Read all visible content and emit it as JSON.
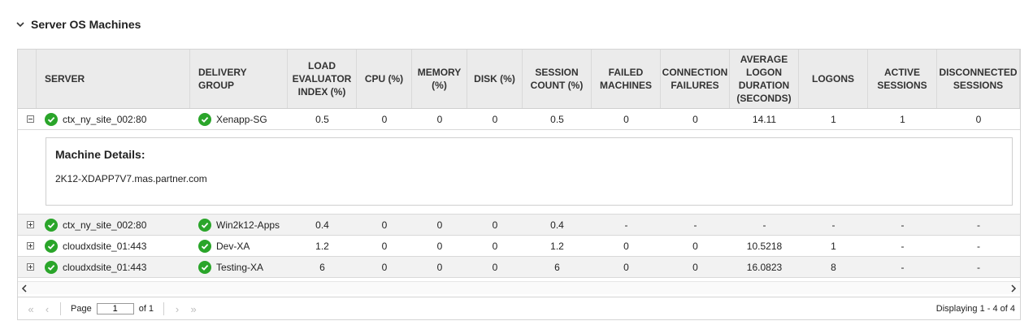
{
  "panel": {
    "title": "Server OS Machines",
    "icon": "chevron-down-icon"
  },
  "columns": [
    "SERVER",
    "DELIVERY GROUP",
    "LOAD EVALUATOR INDEX (%)",
    "CPU (%)",
    "MEMORY (%)",
    "DISK (%)",
    "SESSION COUNT (%)",
    "FAILED MACHINES",
    "CONNECTION FAILURES",
    "AVERAGE LOGON DURATION (SECONDS)",
    "LOGONS",
    "ACTIVE SESSIONS",
    "DISCONNECTED SESSIONS"
  ],
  "rows": [
    {
      "expanded": true,
      "server": "ctx_ny_site_002:80",
      "group": "Xenapp-SG",
      "lei": "0.5",
      "cpu": "0",
      "mem": "0",
      "disk": "0",
      "sess": "0.5",
      "failed": "0",
      "connfail": "0",
      "avglogon": "14.11",
      "logons": "1",
      "active": "1",
      "disc": "0"
    },
    {
      "expanded": false,
      "server": "ctx_ny_site_002:80",
      "group": "Win2k12-Apps",
      "lei": "0.4",
      "cpu": "0",
      "mem": "0",
      "disk": "0",
      "sess": "0.4",
      "failed": "-",
      "connfail": "-",
      "avglogon": "-",
      "logons": "-",
      "active": "-",
      "disc": "-"
    },
    {
      "expanded": false,
      "server": "cloudxdsite_01:443",
      "group": "Dev-XA",
      "lei": "1.2",
      "cpu": "0",
      "mem": "0",
      "disk": "0",
      "sess": "1.2",
      "failed": "0",
      "connfail": "0",
      "avglogon": "10.5218",
      "logons": "1",
      "active": "-",
      "disc": "-"
    },
    {
      "expanded": false,
      "server": "cloudxdsite_01:443",
      "group": "Testing-XA",
      "lei": "6",
      "cpu": "0",
      "mem": "0",
      "disk": "0",
      "sess": "6",
      "failed": "0",
      "connfail": "0",
      "avglogon": "16.0823",
      "logons": "8",
      "active": "-",
      "disc": "-"
    }
  ],
  "details": {
    "title": "Machine Details:",
    "host": "2K12-XDAPP7V7.mas.partner.com"
  },
  "pager": {
    "page_label": "Page",
    "page_value": "1",
    "of_label": "of 1",
    "display_text": "Displaying 1 - 4 of 4"
  },
  "colors": {
    "status_ok": "#2aa52a",
    "header_bg": "#ebebeb",
    "alt_row_bg": "#f2f2f2"
  },
  "icons": {
    "status": "check-circle-icon",
    "first": "first-page-icon",
    "prev": "prev-page-icon",
    "next": "next-page-icon",
    "last": "last-page-icon"
  }
}
